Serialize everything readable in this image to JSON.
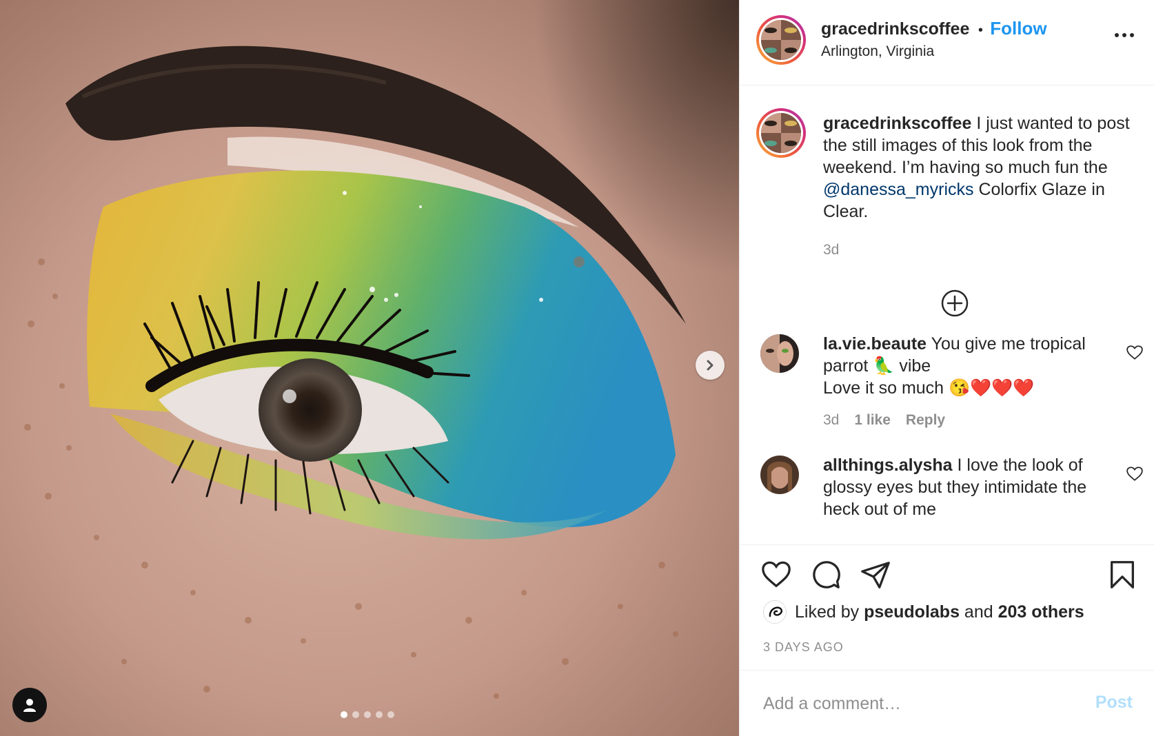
{
  "post": {
    "username": "gracedrinkscoffee",
    "separator": "•",
    "follow_label": "Follow",
    "location": "Arlington, Virginia",
    "caption_username": "gracedrinkscoffee",
    "caption_part1": " I just wanted to post the still images of this look from the weekend. I’m having so much fun the ",
    "caption_mention": "@danessa_myricks",
    "caption_part2": " Colorfix Glaze in Clear.",
    "caption_time": "3d",
    "carousel": {
      "total": 5,
      "active": 1
    }
  },
  "comments": [
    {
      "username": "la.vie.beaute",
      "text_line": " You give me tropical parrot 🦜 vibe",
      "text_line2": "Love it so much 😘❤️❤️❤️",
      "time": "3d",
      "likes": "1 like",
      "reply_label": "Reply"
    },
    {
      "username": "allthings.alysha",
      "text_line": " I love the look of glossy eyes but they intimidate the heck out of me"
    }
  ],
  "actions": {
    "icons": [
      "heart-icon",
      "comment-icon",
      "share-icon",
      "bookmark-icon"
    ],
    "liked_prefix": "Liked by ",
    "liked_user": "pseudolabs",
    "liked_mid": " and ",
    "liked_others": "203 others",
    "timestamp": "3 DAYS AGO"
  },
  "add_comment": {
    "placeholder": "Add a comment…",
    "post_label": "Post"
  },
  "colors": {
    "follow_blue": "#1d95f0",
    "mention_navy": "#00376b",
    "post_disabled": "#b2dffc",
    "muted_gray": "#8e8e8e"
  }
}
